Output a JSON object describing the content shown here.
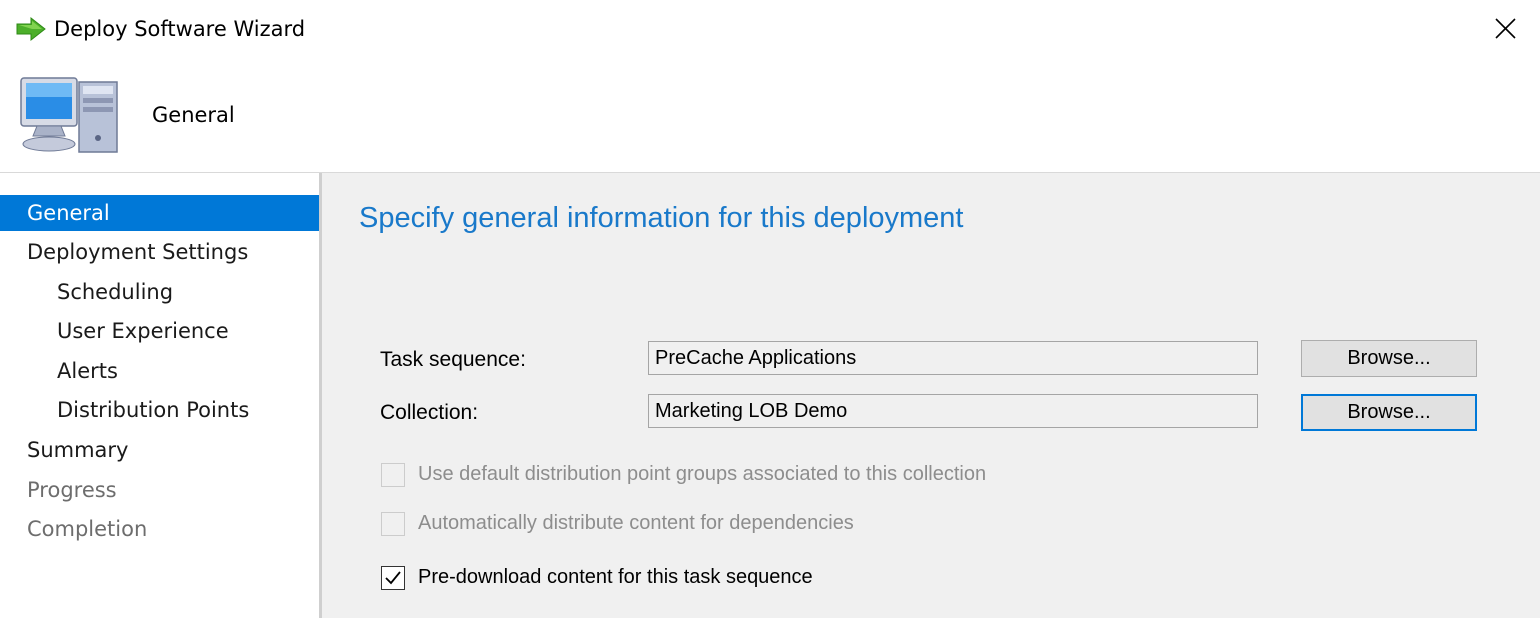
{
  "window": {
    "title": "Deploy Software Wizard",
    "title_icon": "green-arrow-icon",
    "close_icon": "close-icon"
  },
  "header": {
    "icon": "computer-icon",
    "title": "General"
  },
  "sidebar": {
    "items": [
      {
        "label": "General",
        "level": 0,
        "state": "selected"
      },
      {
        "label": "Deployment Settings",
        "level": 0,
        "state": "normal"
      },
      {
        "label": "Scheduling",
        "level": 1,
        "state": "normal"
      },
      {
        "label": "User Experience",
        "level": 1,
        "state": "normal"
      },
      {
        "label": "Alerts",
        "level": 1,
        "state": "normal"
      },
      {
        "label": "Distribution Points",
        "level": 1,
        "state": "normal"
      },
      {
        "label": "Summary",
        "level": 0,
        "state": "normal"
      },
      {
        "label": "Progress",
        "level": 0,
        "state": "disabled"
      },
      {
        "label": "Completion",
        "level": 0,
        "state": "disabled"
      }
    ]
  },
  "main": {
    "heading": "Specify general information for this deployment",
    "task_sequence": {
      "label": "Task sequence:",
      "value": "PreCache Applications",
      "browse_label": "Browse..."
    },
    "collection": {
      "label": "Collection:",
      "value": "Marketing LOB Demo",
      "browse_label": "Browse..."
    },
    "checkboxes": [
      {
        "label": "Use default distribution point groups associated to this collection",
        "checked": false,
        "enabled": false
      },
      {
        "label": "Automatically distribute content for dependencies",
        "checked": false,
        "enabled": false
      },
      {
        "label": "Pre-download content for this task sequence",
        "checked": true,
        "enabled": true
      }
    ]
  },
  "colors": {
    "accent": "#0078d7",
    "heading": "#1979ca",
    "panel": "#f0f0f0"
  }
}
